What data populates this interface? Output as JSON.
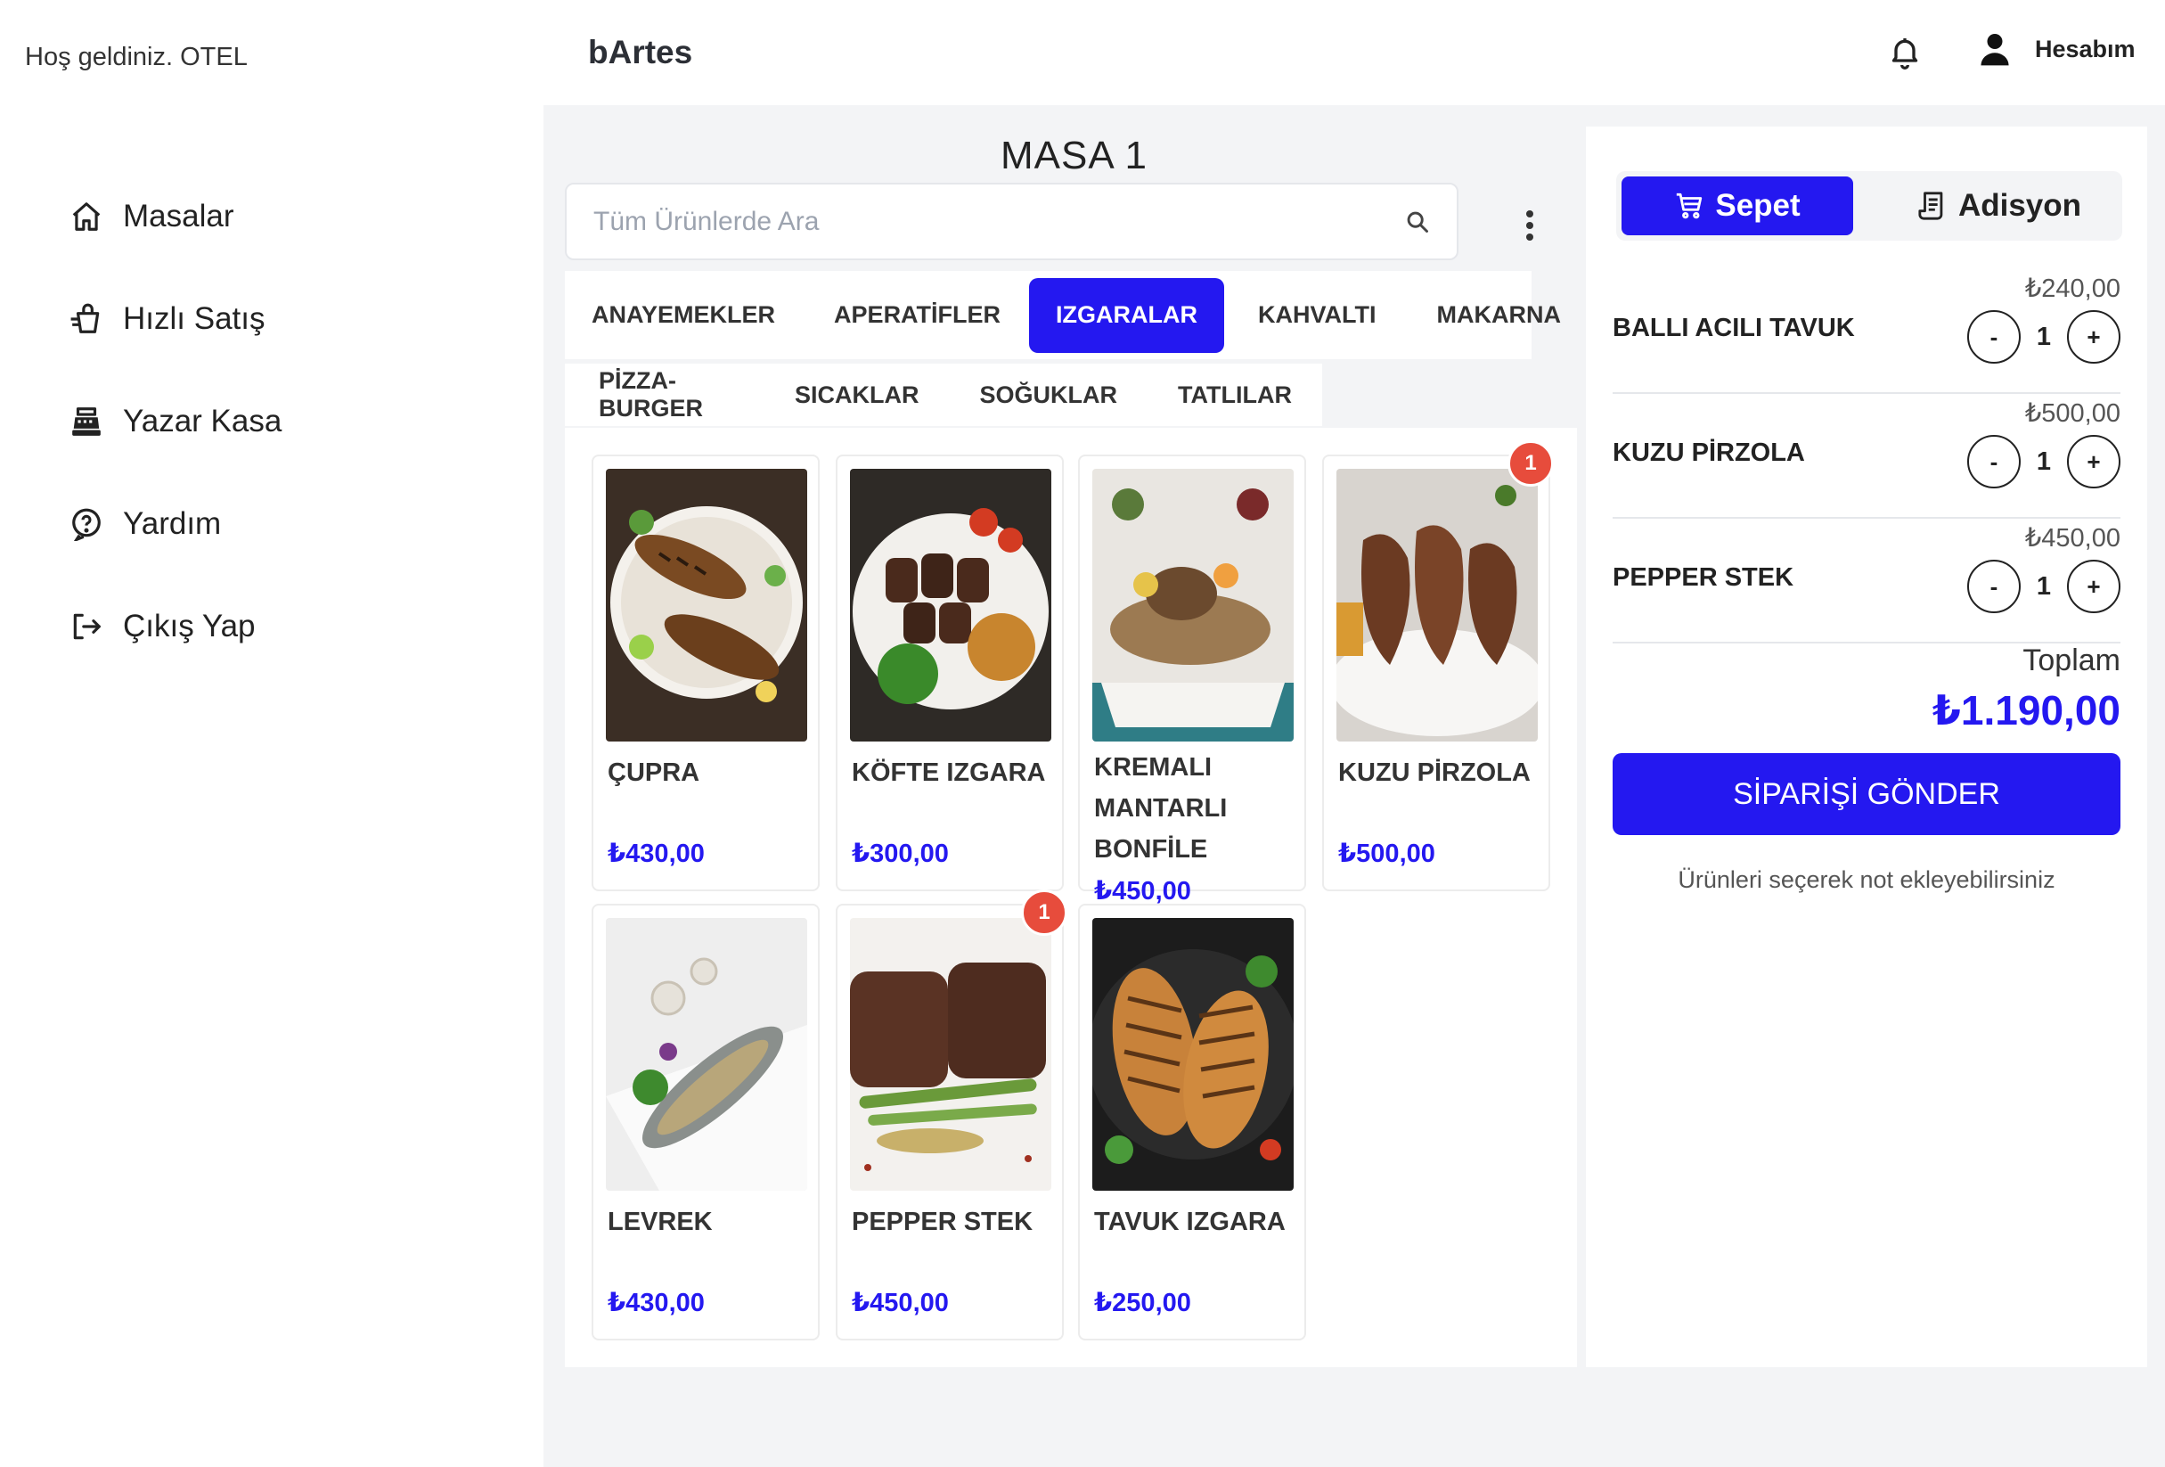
{
  "welcome": "Hoş geldiniz. OTEL",
  "sidebar": {
    "items": [
      {
        "label": "Masalar",
        "icon": "home-icon"
      },
      {
        "label": "Hızlı Satış",
        "icon": "quick-sale-icon"
      },
      {
        "label": "Yazar Kasa",
        "icon": "cash-register-icon"
      },
      {
        "label": "Yardım",
        "icon": "help-icon"
      },
      {
        "label": "Çıkış Yap",
        "icon": "logout-icon"
      }
    ]
  },
  "header": {
    "brand": "bArtes",
    "account_label": "Hesabım"
  },
  "main": {
    "table_title": "MASA 1",
    "search_placeholder": "Tüm Ürünlerde Ara",
    "categories_row1": [
      "ANAYEMEKLER",
      "APERATİFLER",
      "IZGARALAR",
      "KAHVALTI",
      "MAKARNA"
    ],
    "categories_row2": [
      "PİZZA-BURGER",
      "SICAKLAR",
      "SOĞUKLAR",
      "TATLILAR"
    ],
    "active_category": "IZGARALAR",
    "products": [
      {
        "name": "ÇUPRA",
        "price": "₺430,00",
        "badge": ""
      },
      {
        "name": "KÖFTE IZGARA",
        "price": "₺300,00",
        "badge": ""
      },
      {
        "name": "KREMALI MANTARLI BONFİLE",
        "price": "₺450,00",
        "badge": ""
      },
      {
        "name": "KUZU PİRZOLA",
        "price": "₺500,00",
        "badge": "1"
      },
      {
        "name": "LEVREK",
        "price": "₺430,00",
        "badge": ""
      },
      {
        "name": "PEPPER STEK",
        "price": "₺450,00",
        "badge": "1"
      },
      {
        "name": "TAVUK IZGARA",
        "price": "₺250,00",
        "badge": ""
      }
    ]
  },
  "cart": {
    "tabs": {
      "sepet": "Sepet",
      "adisyon": "Adisyon"
    },
    "items": [
      {
        "name": "BALLI ACILI TAVUK",
        "price": "₺240,00",
        "qty": "1"
      },
      {
        "name": "KUZU PİRZOLA",
        "price": "₺500,00",
        "qty": "1"
      },
      {
        "name": "PEPPER STEK",
        "price": "₺450,00",
        "qty": "1"
      }
    ],
    "minus_label": "-",
    "plus_label": "+",
    "total_label": "Toplam",
    "total_value": "₺1.190,00",
    "send_label": "SİPARİŞİ GÖNDER",
    "note": "Ürünleri seçerek not ekleyebilirsiniz"
  },
  "colors": {
    "accent": "#2418f0",
    "badge": "#e74c3c",
    "background": "#f3f4f6"
  }
}
